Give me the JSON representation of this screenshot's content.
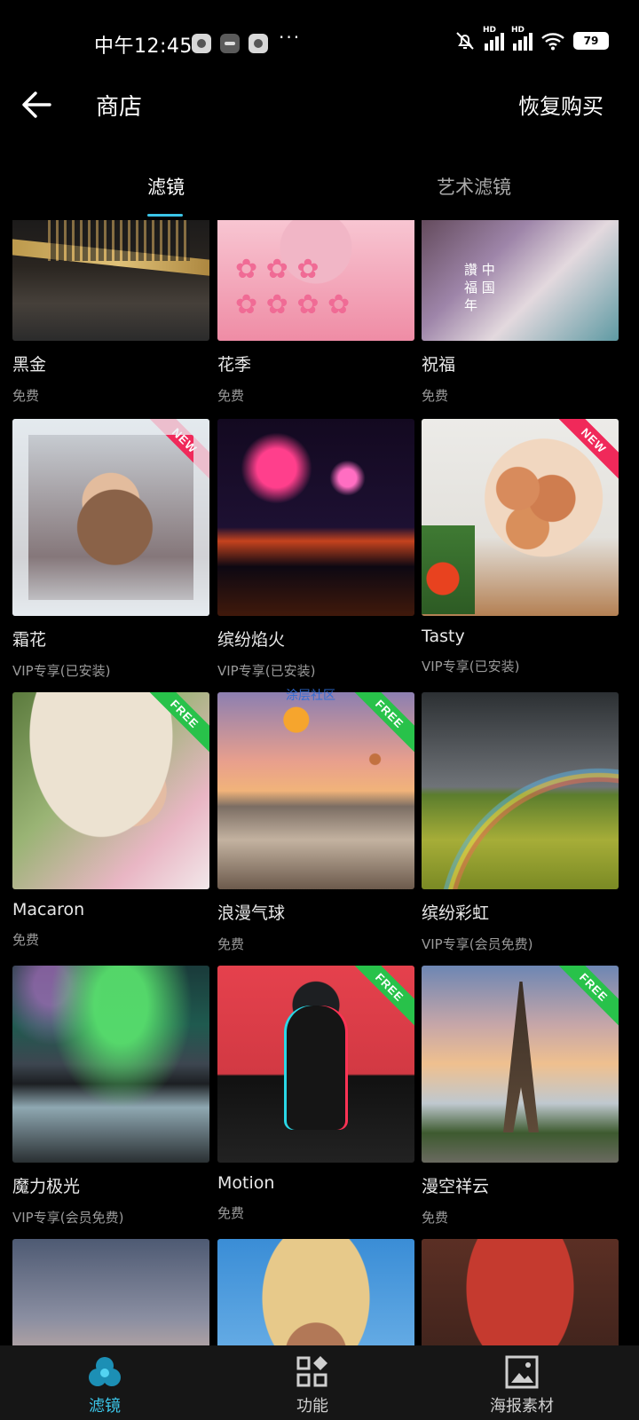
{
  "status_bar": {
    "time": "中午12:45",
    "more_indicator": "···",
    "battery": "79",
    "signal_label_1": "HD",
    "signal_label_2": "HD",
    "icons": [
      "app-notification-icon",
      "chat-bubble-icon",
      "app-icon",
      "mute-bell-icon",
      "signal-icon",
      "signal-icon",
      "wifi-icon",
      "battery-icon"
    ]
  },
  "header": {
    "title": "商店",
    "restore_label": "恢复购买",
    "back_icon": "arrow-left-icon"
  },
  "tabs": [
    {
      "label": "滤镜",
      "active": true
    },
    {
      "label": "艺术滤镜",
      "active": false
    }
  ],
  "watermark": "涂层社区",
  "items": [
    {
      "name": "黑金",
      "price": "免费",
      "badge": ""
    },
    {
      "name": "花季",
      "price": "免费",
      "badge": ""
    },
    {
      "name": "祝福",
      "price": "免费",
      "badge": ""
    },
    {
      "name": "霜花",
      "price": "VIP专享(已安装)",
      "badge": "NEW"
    },
    {
      "name": "缤纷焰火",
      "price": "VIP专享(已安装)",
      "badge": ""
    },
    {
      "name": "Tasty",
      "price": "VIP专享(已安装)",
      "badge": "NEW"
    },
    {
      "name": "Macaron",
      "price": "免费",
      "badge": "FREE"
    },
    {
      "name": "浪漫气球",
      "price": "免费",
      "badge": "FREE"
    },
    {
      "name": "缤纷彩虹",
      "price": "VIP专享(会员免费)",
      "badge": ""
    },
    {
      "name": "魔力极光",
      "price": "VIP专享(会员免费)",
      "badge": ""
    },
    {
      "name": "Motion",
      "price": "免费",
      "badge": "FREE"
    },
    {
      "name": "漫空祥云",
      "price": "免费",
      "badge": "FREE"
    }
  ],
  "bottom_nav": [
    {
      "label": "滤镜",
      "icon": "filter-circles-icon",
      "active": true
    },
    {
      "label": "功能",
      "icon": "grid-shapes-icon",
      "active": false
    },
    {
      "label": "海报素材",
      "icon": "image-frame-icon",
      "active": false
    }
  ],
  "colors": {
    "accent": "#3bc5e8",
    "background": "#000000",
    "badge_new": "#f0295a",
    "badge_free": "#28c24a"
  }
}
